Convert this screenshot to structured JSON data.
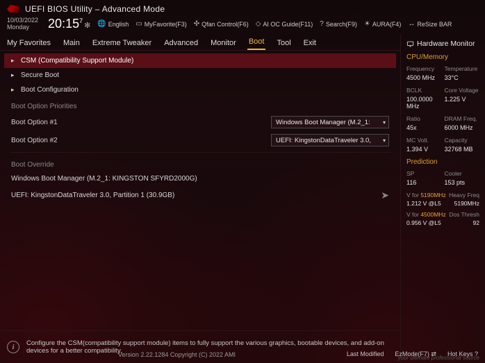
{
  "title": "UEFI BIOS Utility – Advanced Mode",
  "date": "10/03/2022",
  "day": "Monday",
  "time": "20:15",
  "time_exp": "7",
  "utils": {
    "lang": "English",
    "fav": "MyFavorite(F3)",
    "qfan": "Qfan Control(F6)",
    "aioc": "AI OC Guide(F11)",
    "search": "Search(F9)",
    "aura": "AURA(F4)",
    "resize": "ReSize BAR"
  },
  "tabs": [
    "My Favorites",
    "Main",
    "Extreme Tweaker",
    "Advanced",
    "Monitor",
    "Boot",
    "Tool",
    "Exit"
  ],
  "active_tab": "Boot",
  "menu": {
    "csm": "CSM (Compatibility Support Module)",
    "secure": "Secure Boot",
    "bootcfg": "Boot Configuration"
  },
  "boot_priorities_label": "Boot Option Priorities",
  "boot_options": [
    {
      "label": "Boot Option #1",
      "value": "Windows Boot Manager (M.2_1:"
    },
    {
      "label": "Boot Option #2",
      "value": "UEFI: KingstonDataTraveler 3.0,"
    }
  ],
  "override_label": "Boot Override",
  "override_items": [
    "Windows Boot Manager (M.2_1: KINGSTON SFYRD2000G)",
    "UEFI: KingstonDataTraveler 3.0, Partition 1 (30.9GB)"
  ],
  "help_text": "Configure the CSM(compatibility support module) items to fully support the various graphics, bootable devices, and add-on devices for a better compatibility.",
  "footer": {
    "version": "Version 2.22.1284 Copyright (C) 2022 AMI",
    "last_mod": "Last Modified",
    "ezmode": "EzMode(F7)",
    "hotkeys": "Hot Keys",
    "watermark": "your ultimate professional source"
  },
  "hw": {
    "title": "Hardware Monitor",
    "cpu_mem": "CPU/Memory",
    "freq_l": "Frequency",
    "freq_v": "4500 MHz",
    "temp_l": "Temperature",
    "temp_v": "33°C",
    "bclk_l": "BCLK",
    "bclk_v": "100.0000 MHz",
    "cv_l": "Core Voltage",
    "cv_v": "1.225 V",
    "ratio_l": "Ratio",
    "ratio_v": "45x",
    "dram_l": "DRAM Freq.",
    "dram_v": "6000 MHz",
    "mcv_l": "MC Volt.",
    "mcv_v": "1.394 V",
    "cap_l": "Capacity",
    "cap_v": "32768 MB",
    "pred": "Prediction",
    "sp_l": "SP",
    "sp_v": "116",
    "cool_l": "Cooler",
    "cool_v": "153 pts",
    "vhi_pre": "V for ",
    "vhi_f": "5190MHz",
    "vhi_l": "Heavy Freq",
    "vhi_v": "1.212 V @L5",
    "vhi_r": "5190MHz",
    "vlo_f": "4500MHz",
    "vlo_l": "Dos Thresh",
    "vlo_v": "0.956 V @L5",
    "vlo_r": "92"
  }
}
